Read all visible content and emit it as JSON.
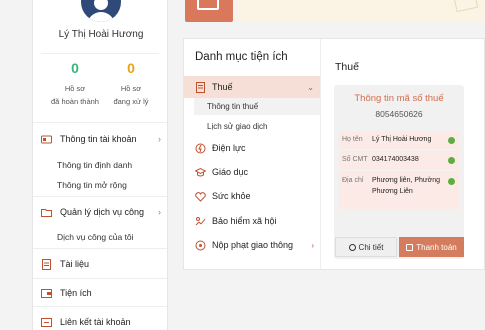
{
  "user": {
    "name": "Lý Thị Hoài Hương"
  },
  "stats": [
    {
      "value": "0",
      "label_line1": "Hồ sơ",
      "label_line2": "đã hoàn thành",
      "color": "#37b57a"
    },
    {
      "value": "0",
      "label_line1": "Hồ sơ",
      "label_line2": "đang xử lý",
      "color": "#e8a21a"
    }
  ],
  "sidebar": {
    "items": [
      {
        "label": "Thông tin tài khoản",
        "icon": "account-card-icon"
      },
      {
        "label": "Quản lý dịch vụ công",
        "icon": "folder-icon"
      },
      {
        "label": "Tài liệu",
        "icon": "document-icon"
      },
      {
        "label": "Tiện ích",
        "icon": "utility-icon"
      },
      {
        "label": "Liên kết tài khoản",
        "icon": "link-icon"
      }
    ],
    "account_sub": [
      "Thông tin định danh",
      "Thông tin mở rộng"
    ],
    "service_sub": [
      "Dịch vụ công của tôi"
    ]
  },
  "catalog": {
    "title": "Danh mục tiện ích",
    "items": [
      {
        "label": "Thuế",
        "icon": "tax-icon"
      },
      {
        "label": "Điện lực",
        "icon": "electricity-icon"
      },
      {
        "label": "Giáo dục",
        "icon": "education-icon"
      },
      {
        "label": "Sức khỏe",
        "icon": "health-icon"
      },
      {
        "label": "Bảo hiểm xã hội",
        "icon": "insurance-icon"
      },
      {
        "label": "Nộp phạt giao thông",
        "icon": "traffic-fine-icon"
      }
    ],
    "tax_sub": [
      "Thông tin thuế",
      "Lịch sử giao dịch"
    ]
  },
  "tax": {
    "heading": "Thuế",
    "box_title": "Thông tin mã số thuế",
    "tax_code": "8054650626",
    "rows": [
      {
        "key": "Họ tên",
        "value": "Lý Thị Hoài Hương"
      },
      {
        "key": "Số CMT",
        "value": "034174003438"
      },
      {
        "key": "Địa chỉ",
        "value": "Phương liên, Phường Phương Liên"
      }
    ],
    "detail_button": "Chi tiết",
    "pay_button": "Thanh toán"
  },
  "colors": {
    "accent": "#d47d5e",
    "success": "#5aaf3e",
    "highlight": "#f6dfd6"
  }
}
